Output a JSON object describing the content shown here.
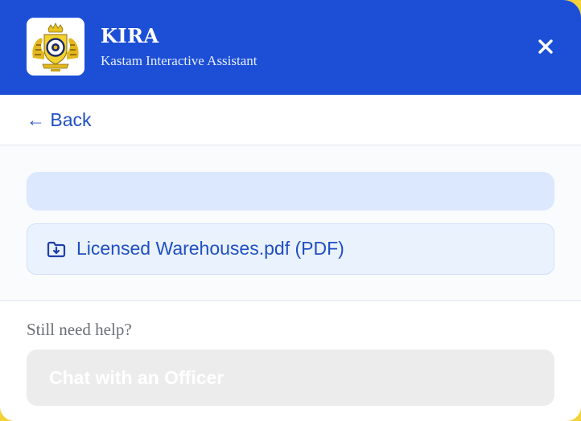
{
  "header": {
    "title": "KIRA",
    "subtitle": "Kastam Interactive Assistant",
    "logo_icon": "royal-customs-crest-icon",
    "close_icon": "close-icon"
  },
  "navigation": {
    "back_label": "← Back"
  },
  "attachments": [
    {
      "icon": "folder-download-icon",
      "label": "Licensed Warehouses.pdf (PDF)"
    }
  ],
  "footer": {
    "help_text": "Still need help?",
    "chat_button_label": "Chat with an Officer",
    "chat_button_enabled": false
  },
  "colors": {
    "header_blue": "#1c4fd6",
    "link_blue": "#1f4fc2",
    "empty_bar": "#dbe8fd",
    "file_card": "#eaf2fe",
    "disabled_button": "#ececec"
  }
}
